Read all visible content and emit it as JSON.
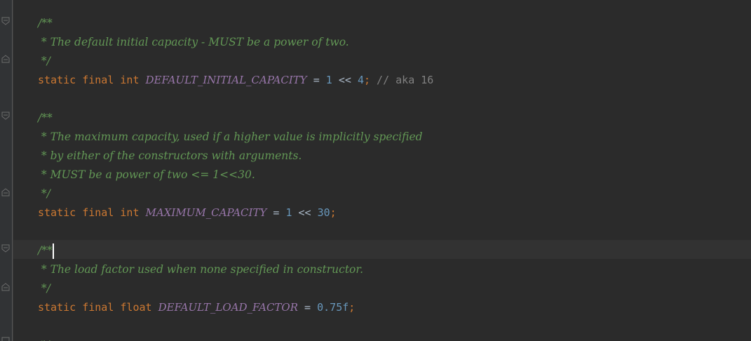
{
  "lines": [
    {
      "doc": "/**"
    },
    {
      "doc": " * The default initial capacity - MUST be a power of two."
    },
    {
      "doc": " */"
    },
    {
      "kw": "static final int ",
      "name": "DEFAULT_INITIAL_CAPACITY",
      "eq": " = ",
      "v1": "1",
      "op2": " << ",
      "v2": "4",
      "semi": ";",
      "comment": " // aka 16"
    },
    {
      "doc": ""
    },
    {
      "doc": "/**"
    },
    {
      "doc": " * The maximum capacity, used if a higher value is implicitly specified"
    },
    {
      "doc": " * by either of the constructors with arguments."
    },
    {
      "doc": " * MUST be a power of two <= 1<<30."
    },
    {
      "doc": " */"
    },
    {
      "kw": "static final int ",
      "name": "MAXIMUM_CAPACITY",
      "eq": " = ",
      "v1": "1",
      "op2": " << ",
      "v2": "30",
      "semi": ";"
    },
    {
      "doc": ""
    },
    {
      "doc": "/**"
    },
    {
      "doc": " * The load factor used when none specified in constructor."
    },
    {
      "doc": " */"
    },
    {
      "kw": "static final float ",
      "name": "DEFAULT_LOAD_FACTOR",
      "eq": " = ",
      "v1": "0.75f",
      "semi": ";"
    },
    {
      "doc": ""
    },
    {
      "doc": "/**"
    }
  ],
  "colors": {
    "background": "#2b2b2b",
    "doc_comment": "#629755",
    "keyword": "#cc7832",
    "constant": "#9876aa",
    "number": "#6897bb",
    "comment": "#808080",
    "operator": "#a9b7c6"
  }
}
